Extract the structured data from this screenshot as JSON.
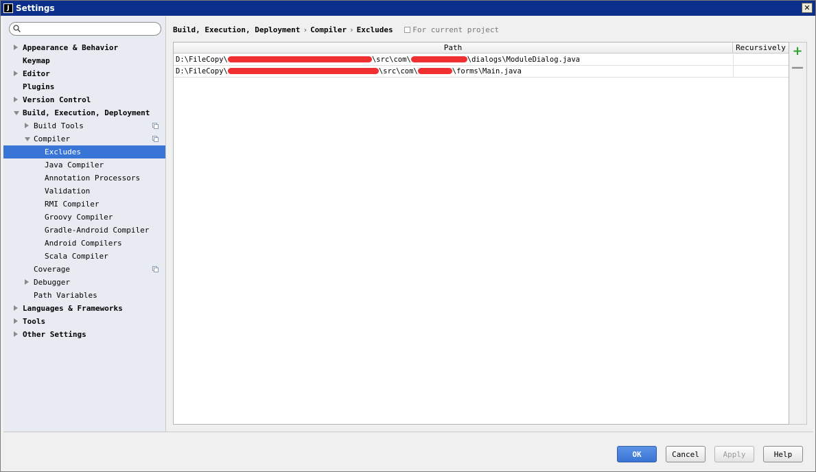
{
  "window": {
    "title": "Settings",
    "app_icon": "J",
    "close_glyph": "✕"
  },
  "search": {
    "value": "",
    "placeholder": ""
  },
  "sidebar": {
    "items": [
      {
        "label": "Appearance & Behavior",
        "bold": true,
        "level": 0,
        "arrow": "right",
        "copy": false,
        "selected": false
      },
      {
        "label": "Keymap",
        "bold": true,
        "level": 0,
        "arrow": "",
        "copy": false,
        "selected": false
      },
      {
        "label": "Editor",
        "bold": true,
        "level": 0,
        "arrow": "right",
        "copy": false,
        "selected": false
      },
      {
        "label": "Plugins",
        "bold": true,
        "level": 0,
        "arrow": "",
        "copy": false,
        "selected": false
      },
      {
        "label": "Version Control",
        "bold": true,
        "level": 0,
        "arrow": "right",
        "copy": false,
        "selected": false
      },
      {
        "label": "Build, Execution, Deployment",
        "bold": true,
        "level": 0,
        "arrow": "down",
        "copy": false,
        "selected": false
      },
      {
        "label": "Build Tools",
        "bold": false,
        "level": 1,
        "arrow": "right",
        "copy": true,
        "selected": false
      },
      {
        "label": "Compiler",
        "bold": false,
        "level": 1,
        "arrow": "down",
        "copy": true,
        "selected": false
      },
      {
        "label": "Excludes",
        "bold": false,
        "level": 2,
        "arrow": "",
        "copy": false,
        "selected": true
      },
      {
        "label": "Java Compiler",
        "bold": false,
        "level": 2,
        "arrow": "",
        "copy": false,
        "selected": false
      },
      {
        "label": "Annotation Processors",
        "bold": false,
        "level": 2,
        "arrow": "",
        "copy": false,
        "selected": false
      },
      {
        "label": "Validation",
        "bold": false,
        "level": 2,
        "arrow": "",
        "copy": false,
        "selected": false
      },
      {
        "label": "RMI Compiler",
        "bold": false,
        "level": 2,
        "arrow": "",
        "copy": false,
        "selected": false
      },
      {
        "label": "Groovy Compiler",
        "bold": false,
        "level": 2,
        "arrow": "",
        "copy": false,
        "selected": false
      },
      {
        "label": "Gradle-Android Compiler",
        "bold": false,
        "level": 2,
        "arrow": "",
        "copy": false,
        "selected": false
      },
      {
        "label": "Android Compilers",
        "bold": false,
        "level": 2,
        "arrow": "",
        "copy": false,
        "selected": false
      },
      {
        "label": "Scala Compiler",
        "bold": false,
        "level": 2,
        "arrow": "",
        "copy": false,
        "selected": false
      },
      {
        "label": "Coverage",
        "bold": false,
        "level": 1,
        "arrow": "",
        "copy": true,
        "selected": false
      },
      {
        "label": "Debugger",
        "bold": false,
        "level": 1,
        "arrow": "right",
        "copy": false,
        "selected": false
      },
      {
        "label": "Path Variables",
        "bold": false,
        "level": 1,
        "arrow": "",
        "copy": false,
        "selected": false
      },
      {
        "label": "Languages & Frameworks",
        "bold": true,
        "level": 0,
        "arrow": "right",
        "copy": false,
        "selected": false
      },
      {
        "label": "Tools",
        "bold": true,
        "level": 0,
        "arrow": "right",
        "copy": false,
        "selected": false
      },
      {
        "label": "Other Settings",
        "bold": true,
        "level": 0,
        "arrow": "right",
        "copy": false,
        "selected": false
      }
    ]
  },
  "breadcrumb": {
    "parts": [
      "Build, Execution, Deployment",
      "Compiler",
      "Excludes"
    ],
    "separator": "›",
    "scope": "For current project"
  },
  "table": {
    "columns": {
      "path": "Path",
      "recursively": "Recursively"
    },
    "rows": [
      {
        "segments": [
          "D:\\FileCopy\\",
          "#",
          "\\src\\com\\",
          "#",
          "\\dialogs\\ModuleDialog.java"
        ],
        "recursively": ""
      },
      {
        "segments": [
          "D:\\FileCopy\\",
          "#",
          "\\src\\com\\",
          "#",
          "\\forms\\Main.java"
        ],
        "recursively": ""
      }
    ]
  },
  "tools": {
    "add": "+",
    "remove": "—"
  },
  "buttons": {
    "ok": "OK",
    "cancel": "Cancel",
    "apply": "Apply",
    "help": "Help"
  },
  "colors": {
    "selection": "#3875d7",
    "add_icon": "#2ea42e",
    "redaction": "#f03030"
  }
}
